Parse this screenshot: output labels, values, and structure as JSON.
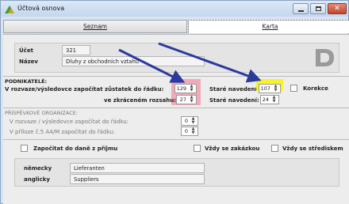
{
  "window": {
    "title": "Účtová osnova",
    "minimize_icon": "minimize-icon",
    "maximize_icon": "maximize-icon",
    "close_icon": "close-icon"
  },
  "tabs": [
    {
      "label": "Seznam"
    },
    {
      "label": "Karta"
    }
  ],
  "header": {
    "ucet_label": "Účet",
    "ucet_value": "321",
    "nazev_label": "Název",
    "nazev_value": "Dluhy z obchodních vztahů"
  },
  "podnikatele": {
    "heading": "PODNIKATELÉ:",
    "row1_label": "V rozvaze/výsledovce započítat zůstatek do řádku:",
    "row1_value": "129",
    "row1_stare_label": "Staré navedení:",
    "row1_stare_value": "107",
    "korekce_label": "Korekce",
    "row2_label": "ve zkráceném rozsahu:",
    "row2_value": "27",
    "row2_stare_label": "Staré navedení:",
    "row2_stare_value": "24"
  },
  "prispevkove": {
    "heading": "PŘÍSPĚVKOVÉ ORGANIZACE:",
    "row1_label": "V rozvaze / výsledovce započítat do řádku:",
    "row1_value": "0",
    "row2_label": "V příloze č.5 A4/M započítat do řádku:",
    "row2_value": "0"
  },
  "checks": {
    "zapocitat_label": "Započítat do daně z příjmu",
    "zakazkou_label": "Vždy se zakázkou",
    "strediskem_label": "Vždy se střediskem"
  },
  "translations": {
    "nemecky_label": "německy",
    "nemecky_value": "Lieferanten",
    "anglicky_label": "anglicky",
    "anglicky_value": "Suppliers"
  },
  "colors": {
    "highlight_red": "#f1aab9",
    "highlight_yellow": "#f7f32a",
    "arrow": "#2b3a9c"
  }
}
